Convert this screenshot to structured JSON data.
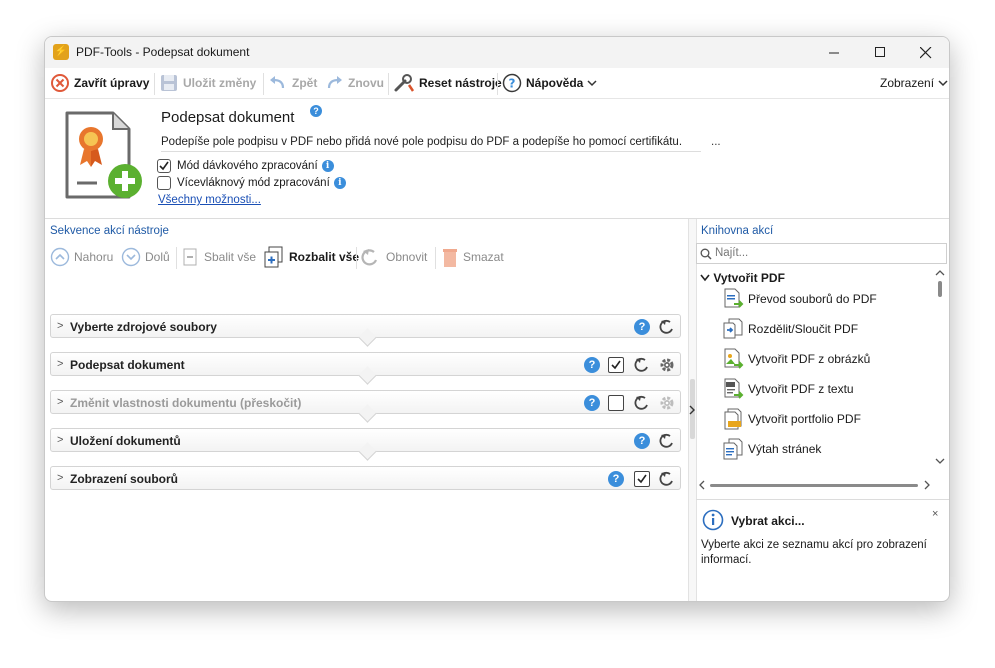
{
  "window": {
    "title": "PDF-Tools - Podepsat dokument",
    "app_icon_glyph": "⚡",
    "minimize": "—",
    "maximize": "☐",
    "close": "✕"
  },
  "toolbar": {
    "close_edit": "Zavřít úpravy",
    "save": "Uložit změny",
    "undo": "Zpět",
    "redo": "Znovu",
    "reset": "Reset nástroje",
    "help": "Nápověda",
    "view": "Zobrazení"
  },
  "header": {
    "title": "Podepsat dokument",
    "description": "Podepíše pole podpisu v PDF nebo přidá nové pole podpisu do PDF a podepíše ho pomocí certifikátu.",
    "more": "...",
    "batch_mode": {
      "label": "Mód dávkového zpracování",
      "checked": true
    },
    "multithread_mode": {
      "label": "Vícevláknový mód zpracování",
      "checked": false
    },
    "all_options": "Všechny možnosti..."
  },
  "sequence": {
    "title": "Sekvence akcí nástroje",
    "toolbar": {
      "up": "Nahoru",
      "down": "Dolů",
      "collapse": "Sbalit vše",
      "expand": "Rozbalit vše",
      "refresh": "Obnovit",
      "delete": "Smazat"
    },
    "actions": [
      {
        "label": "Vyberte zdrojové soubory",
        "skipped": false
      },
      {
        "label": "Podepsat dokument",
        "skipped": false
      },
      {
        "label": "Změnit vlastnosti dokumentu (přeskočit)",
        "skipped": true
      },
      {
        "label": "Uložení dokumentů",
        "skipped": false
      },
      {
        "label": "Zobrazení souborů",
        "skipped": false
      }
    ]
  },
  "library": {
    "title": "Knihovna akcí",
    "search_placeholder": "Najít...",
    "category": "Vytvořit PDF",
    "items": [
      {
        "label": "Převod souborů do PDF"
      },
      {
        "label": "Rozdělit/Sloučit PDF"
      },
      {
        "label": "Vytvořit PDF z obrázků"
      },
      {
        "label": "Vytvořit PDF z textu"
      },
      {
        "label": "Vytvořit portfolio PDF"
      },
      {
        "label": "Výtah stránek"
      }
    ]
  },
  "info_panel": {
    "title": "Vybrat akci...",
    "text": "Vyberte akci ze seznamu akcí pro zobrazení informací.",
    "close": "×"
  },
  "colors": {
    "accent_blue": "#3b8edb",
    "link": "#1a4fb5",
    "green_plus": "#5bb030",
    "badge_orange": "#e8762d"
  }
}
